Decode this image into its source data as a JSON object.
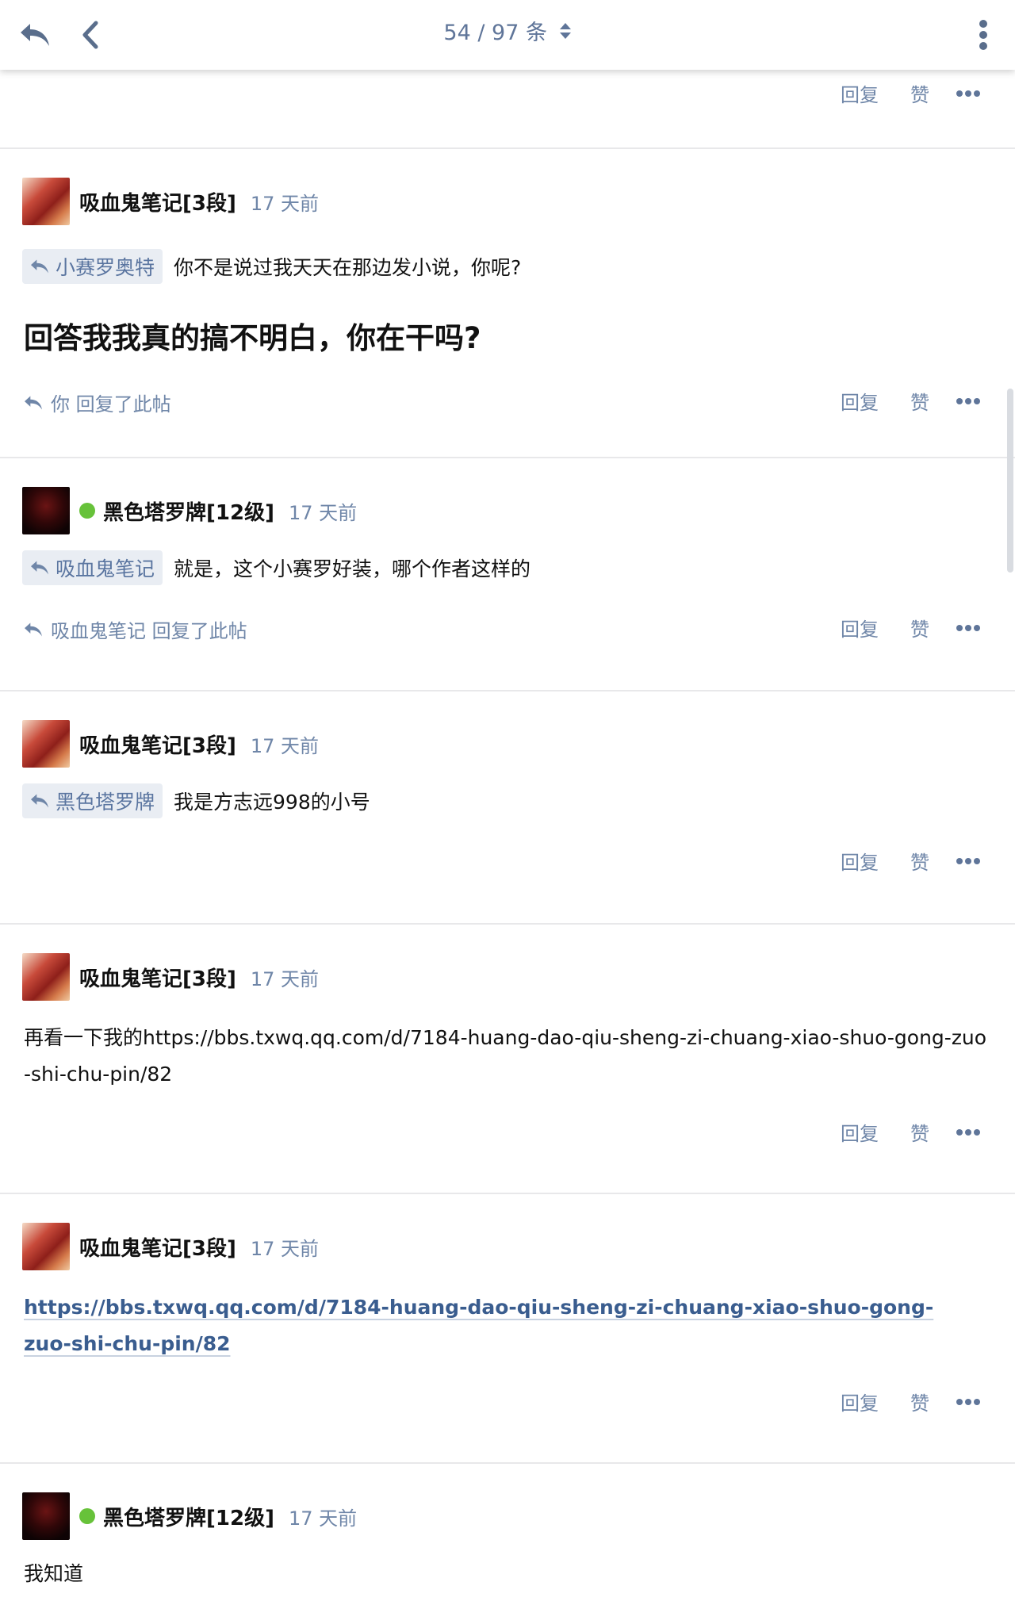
{
  "header": {
    "pager_text": "54 / 97 条",
    "icons": [
      "reply-back-icon",
      "chevron-left-icon",
      "sort-updown-icon",
      "kebab-menu-icon"
    ]
  },
  "actions": {
    "reply": "回复",
    "like": "赞",
    "more_icon": "ellipsis-icon"
  },
  "posts": [
    {
      "username": "吸血鬼笔记[3段]",
      "time": "17 天前",
      "reply_to": "小赛罗奥特",
      "text": "你不是说过我天天在那边发小说，你呢?",
      "big_text": "回答我我真的搞不明白，你在干吗?",
      "replied_note": "你 回复了此帖"
    },
    {
      "username": "黑色塔罗牌[12级]",
      "time": "17 天前",
      "reply_to": "吸血鬼笔记",
      "text": "就是，这个小赛罗好装，哪个作者这样的",
      "replied_note": "吸血鬼笔记 回复了此帖"
    },
    {
      "username": "吸血鬼笔记[3段]",
      "time": "17 天前",
      "reply_to": "黑色塔罗牌",
      "text": "我是方志远998的小号"
    },
    {
      "username": "吸血鬼笔记[3段]",
      "time": "17 天前",
      "text": "再看一下我的https://bbs.txwq.qq.com/d/7184-huang-dao-qiu-sheng-zi-chuang-xiao-shuo-gong-zuo-shi-chu-pin/82"
    },
    {
      "username": "吸血鬼笔记[3段]",
      "time": "17 天前",
      "link": "https://bbs.txwq.qq.com/d/7184-huang-dao-qiu-sheng-zi-chuang-xiao-shuo-gong-zuo-shi-chu-pin/82"
    },
    {
      "username": "黑色塔罗牌[12级]",
      "time": "17 天前",
      "text": "我知道"
    }
  ],
  "colors": {
    "accent": "#5f7599",
    "online": "#67c23a",
    "link": "#3a5d8f"
  }
}
